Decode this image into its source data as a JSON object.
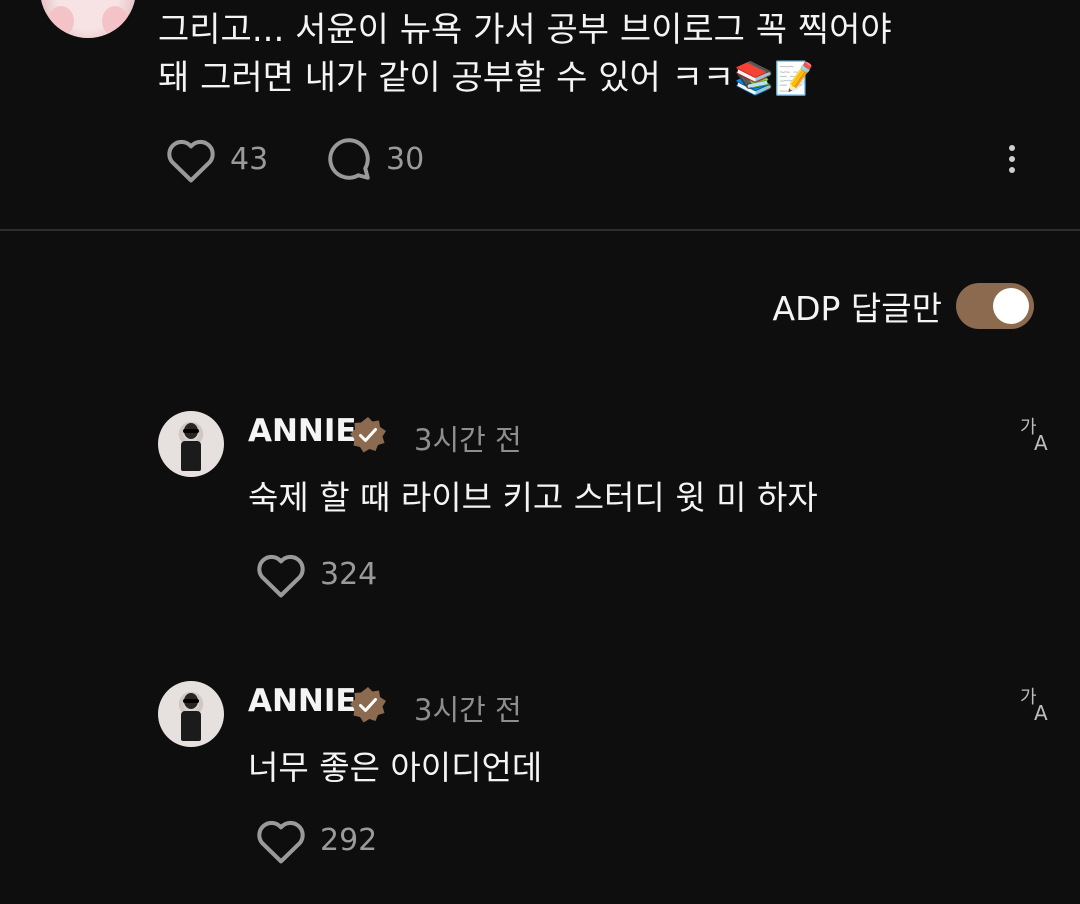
{
  "post": {
    "lines": [
      "그리고... 서윤이 뉴욕 가서 공부 브이로그 꼭 찍어야",
      "돼 그러면 내가 같이 공부할 수 있어 ㅋㅋ"
    ],
    "emojis": [
      "📚",
      "📝"
    ],
    "likes": "43",
    "comments": "30"
  },
  "filter": {
    "label": "ADP 답글만",
    "enabled": true,
    "toggle_color": "#8b6a4f"
  },
  "replies": [
    {
      "name": "ANNIE",
      "verified": true,
      "time": "3시간 전",
      "text": "숙제 할 때 라이브 키고 스터디 윗 미 하자",
      "likes": "324"
    },
    {
      "name": "ANNIE",
      "verified": true,
      "time": "3시간 전",
      "text": "너무 좋은 아이디언데",
      "likes": "292"
    }
  ],
  "icons": {
    "like": "heart-outline-icon",
    "comment": "speech-bubble-icon",
    "more": "more-vertical-icon",
    "verified": "verified-badge-icon",
    "translate": "translate-icon"
  }
}
